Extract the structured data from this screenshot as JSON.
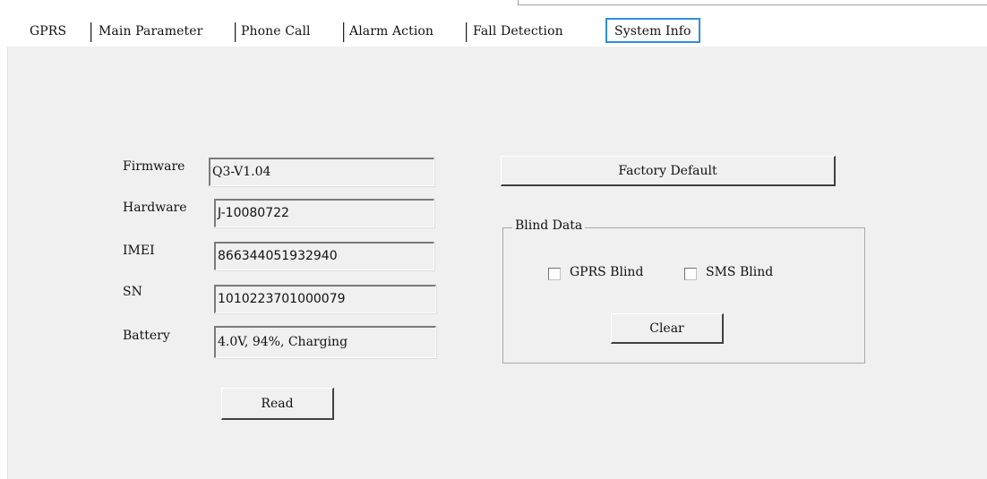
{
  "tabs": [
    {
      "label": "GPRS"
    },
    {
      "label": "Main Parameter"
    },
    {
      "label": "Phone Call"
    },
    {
      "label": "Alarm Action"
    },
    {
      "label": "Fall Detection"
    },
    {
      "label": "System Info",
      "active": true
    }
  ],
  "info": {
    "firmware_label": "Firmware",
    "firmware_value": "Q3-V1.04",
    "hardware_label": "Hardware",
    "hardware_value": "J-10080722",
    "imei_label": "IMEI",
    "imei_value": "866344051932940",
    "sn_label": "SN",
    "sn_value": "1010223701000079",
    "battery_label": "Battery",
    "battery_value": "4.0V, 94%, Charging",
    "read_button": "Read"
  },
  "factory_default_button": "Factory Default",
  "blind_data": {
    "legend": "Blind Data",
    "gprs_blind_label": "GPRS Blind",
    "gprs_blind_checked": false,
    "sms_blind_label": "SMS Blind",
    "sms_blind_checked": false,
    "clear_button": "Clear"
  },
  "colors": {
    "active_tab_border": "#2f8fd8",
    "panel_background": "#f0f0f0"
  }
}
